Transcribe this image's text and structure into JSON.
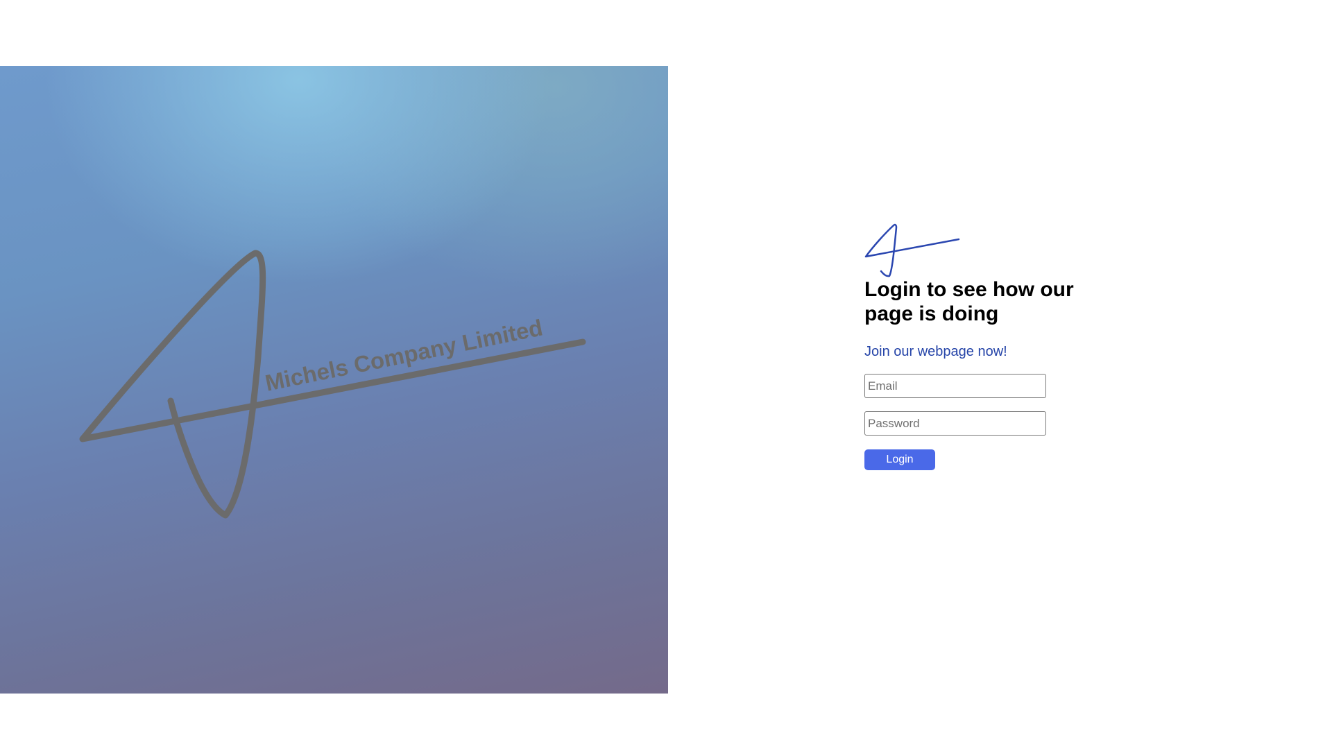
{
  "hero": {
    "company_name": "Michels Company Limited",
    "stroke_color": "#6b6b6b"
  },
  "login": {
    "title": "Login to see how our page is doing",
    "subtitle": "Join our webpage now!",
    "email_placeholder": "Email",
    "email_value": "",
    "password_placeholder": "Password",
    "password_value": "",
    "button_label": "Login"
  },
  "colors": {
    "accent": "#4a69e8",
    "subtitle": "#2544a8",
    "logo_stroke": "#2a46b0"
  }
}
